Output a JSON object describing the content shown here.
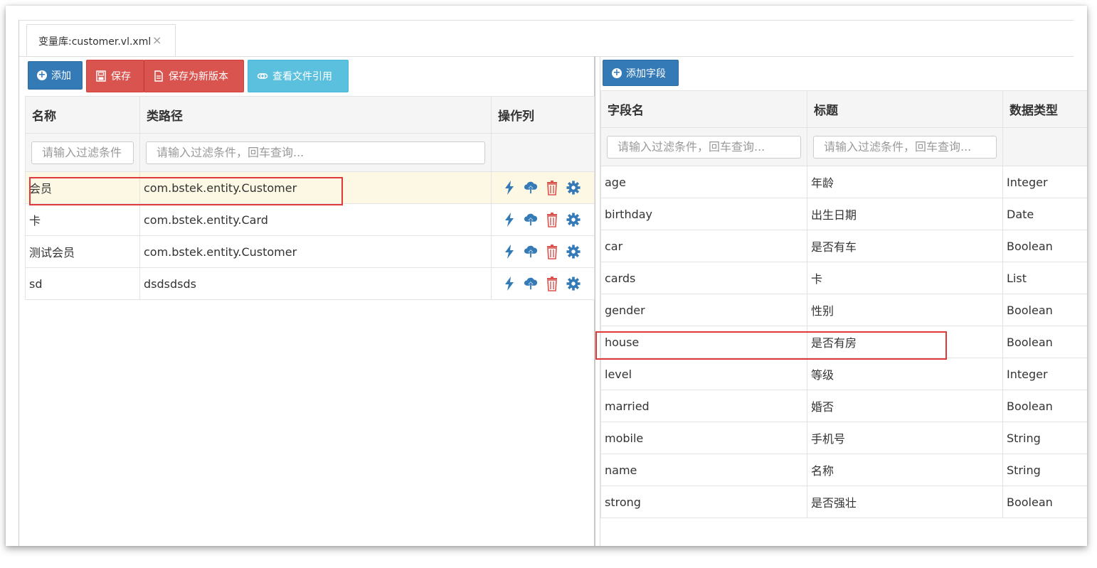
{
  "tab": {
    "label": "变量库:customer.vl.xml",
    "close": "×"
  },
  "left_toolbar": {
    "add": "添加",
    "save": "保存",
    "save_new": "保存为新版本",
    "view_refs": "查看文件引用"
  },
  "left_table": {
    "headers": [
      "名称",
      "类路径",
      "操作列"
    ],
    "filter_placeholder": "请输入过滤条件，回车查询...",
    "rows": [
      {
        "name": "会员",
        "class": "com.bstek.entity.Customer",
        "selected": true
      },
      {
        "name": "卡",
        "class": "com.bstek.entity.Card"
      },
      {
        "name": "测试会员",
        "class": "com.bstek.entity.Customer"
      },
      {
        "name": "sd",
        "class": "dsdsdsds"
      }
    ]
  },
  "right_toolbar": {
    "add_field": "添加字段"
  },
  "right_table": {
    "headers": [
      "字段名",
      "标题",
      "数据类型"
    ],
    "filter_placeholder": "请输入过滤条件，回车查询...",
    "rows": [
      {
        "field": "age",
        "title": "年龄",
        "type": "Integer"
      },
      {
        "field": "birthday",
        "title": "出生日期",
        "type": "Date"
      },
      {
        "field": "car",
        "title": "是否有车",
        "type": "Boolean"
      },
      {
        "field": "cards",
        "title": "卡",
        "type": "List"
      },
      {
        "field": "gender",
        "title": "性别",
        "type": "Boolean"
      },
      {
        "field": "house",
        "title": "是否有房",
        "type": "Boolean"
      },
      {
        "field": "level",
        "title": "等级",
        "type": "Integer"
      },
      {
        "field": "married",
        "title": "婚否",
        "type": "Boolean"
      },
      {
        "field": "mobile",
        "title": "手机号",
        "type": "String"
      },
      {
        "field": "name",
        "title": "名称",
        "type": "String"
      },
      {
        "field": "strong",
        "title": "是否强壮",
        "type": "Boolean"
      }
    ]
  },
  "colors": {
    "primary": "#337ab7",
    "danger": "#d9534f",
    "info": "#5bc0de",
    "highlight": "#e0393a",
    "selected_row": "#fdf8e4"
  }
}
